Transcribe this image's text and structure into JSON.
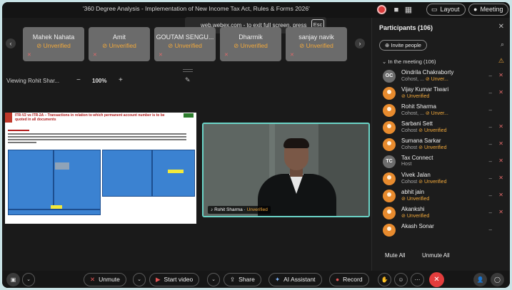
{
  "meeting": {
    "title": "'360 Degree Analysis - Implementation of New Income Tax Act, Rules & Forms 2026'",
    "layout_label": "Layout",
    "meeting_label": "Meeting"
  },
  "toast": {
    "text": "web.webex.com - to exit full screen, press",
    "key": "Esc"
  },
  "tiles": [
    {
      "name": "Mahek Nahata",
      "status": "Unverified"
    },
    {
      "name": "Amit",
      "status": "Unverified"
    },
    {
      "name": "GOUTAM SENGU...",
      "status": "Unverified"
    },
    {
      "name": "Dharmik",
      "status": "Unverified"
    },
    {
      "name": "sanjay navik",
      "status": "Unverified"
    }
  ],
  "viewing": {
    "label": "Viewing Rohit Shar...",
    "zoom": "100%",
    "minus": "−",
    "plus": "+"
  },
  "shared_doc": {
    "title": "ITR-V2 vs ITR-2A – Transactions in relation to which permanent account number is to be quoted in all documents"
  },
  "video": {
    "name": "Rohit Sharma",
    "status": "Unverified"
  },
  "participants": {
    "title": "Participants (106)",
    "invite_label": "Invite people",
    "section_label": "In the meeting (106)",
    "list": [
      {
        "name": "Oindrila Chakraborty",
        "sub": "Cohost, ...",
        "status": "Unver...",
        "initials": "OC",
        "avatar": "init"
      },
      {
        "name": "Vijay Kumar Tiwari",
        "sub": "",
        "status": "Unverified",
        "initials": "",
        "avatar": "pic"
      },
      {
        "name": "Rohit Sharma",
        "sub": "Cohost, ...",
        "status": "Unver...",
        "initials": "",
        "avatar": "pic"
      },
      {
        "name": "Sarbani Sett",
        "sub": "Cohost",
        "status": "Unverified",
        "initials": "",
        "avatar": "pic"
      },
      {
        "name": "Sumana Sarkar",
        "sub": "Cohost",
        "status": "Unverified",
        "initials": "",
        "avatar": "pic"
      },
      {
        "name": "Tax Connect",
        "sub": "Host",
        "status": "",
        "initials": "TC",
        "avatar": "init"
      },
      {
        "name": "Vivek Jalan",
        "sub": "Cohost",
        "status": "Unverified",
        "initials": "",
        "avatar": "pic"
      },
      {
        "name": "abhit jain",
        "sub": "",
        "status": "Unverified",
        "initials": "",
        "avatar": "pic"
      },
      {
        "name": "Akankshi",
        "sub": "",
        "status": "Unverified",
        "initials": "",
        "avatar": "pic"
      },
      {
        "name": "Akash Sonar",
        "sub": "",
        "status": "",
        "initials": "",
        "avatar": "pic"
      }
    ],
    "mute_all": "Mute All",
    "unmute_all": "Unmute All"
  },
  "toolbar": {
    "unmute": "Unmute",
    "start_video": "Start video",
    "share": "Share",
    "ai_assistant": "AI Assistant",
    "record": "Record"
  },
  "colors": {
    "accent_unverified": "#f2a93b",
    "end_call": "#e33d3d",
    "video_border": "#6bd4c7"
  }
}
